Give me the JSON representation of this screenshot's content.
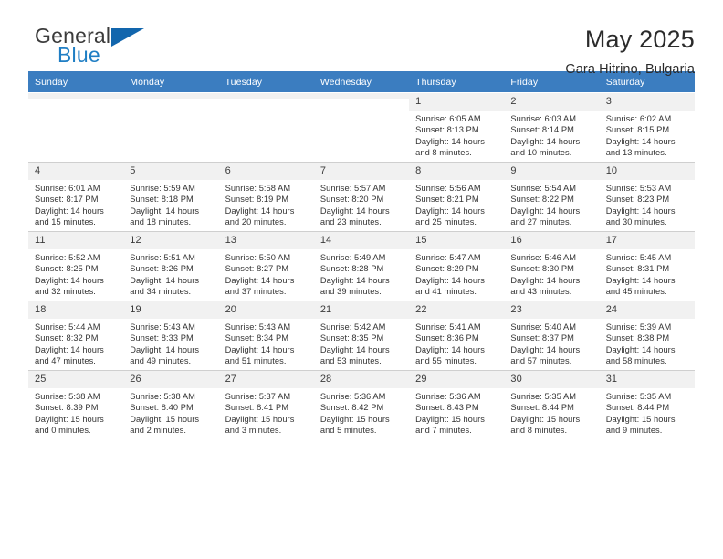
{
  "brand": {
    "word1": "General",
    "word2": "Blue",
    "triangle_color": "#1266ad",
    "blue_color": "#1f7ec4"
  },
  "header": {
    "title": "May 2025",
    "subtitle": "Gara Hitrino, Bulgaria"
  },
  "theme": {
    "header_bg": "#3b7dc0",
    "daynum_bg": "#f1f1f1",
    "grid_line": "#cfcfcf"
  },
  "weekday_headers": [
    "Sunday",
    "Monday",
    "Tuesday",
    "Wednesday",
    "Thursday",
    "Friday",
    "Saturday"
  ],
  "labels": {
    "sunrise_prefix": "Sunrise:",
    "sunset_prefix": "Sunset:",
    "daylight_prefix": "Daylight:"
  },
  "weeks": [
    [
      {
        "day": "",
        "sunrise": "",
        "sunset": "",
        "daylight": "",
        "empty": true
      },
      {
        "day": "",
        "sunrise": "",
        "sunset": "",
        "daylight": "",
        "empty": true
      },
      {
        "day": "",
        "sunrise": "",
        "sunset": "",
        "daylight": "",
        "empty": true
      },
      {
        "day": "",
        "sunrise": "",
        "sunset": "",
        "daylight": "",
        "empty": true
      },
      {
        "day": "1",
        "sunrise": "Sunrise: 6:05 AM",
        "sunset": "Sunset: 8:13 PM",
        "daylight": "Daylight: 14 hours and 8 minutes."
      },
      {
        "day": "2",
        "sunrise": "Sunrise: 6:03 AM",
        "sunset": "Sunset: 8:14 PM",
        "daylight": "Daylight: 14 hours and 10 minutes."
      },
      {
        "day": "3",
        "sunrise": "Sunrise: 6:02 AM",
        "sunset": "Sunset: 8:15 PM",
        "daylight": "Daylight: 14 hours and 13 minutes."
      }
    ],
    [
      {
        "day": "4",
        "sunrise": "Sunrise: 6:01 AM",
        "sunset": "Sunset: 8:17 PM",
        "daylight": "Daylight: 14 hours and 15 minutes."
      },
      {
        "day": "5",
        "sunrise": "Sunrise: 5:59 AM",
        "sunset": "Sunset: 8:18 PM",
        "daylight": "Daylight: 14 hours and 18 minutes."
      },
      {
        "day": "6",
        "sunrise": "Sunrise: 5:58 AM",
        "sunset": "Sunset: 8:19 PM",
        "daylight": "Daylight: 14 hours and 20 minutes."
      },
      {
        "day": "7",
        "sunrise": "Sunrise: 5:57 AM",
        "sunset": "Sunset: 8:20 PM",
        "daylight": "Daylight: 14 hours and 23 minutes."
      },
      {
        "day": "8",
        "sunrise": "Sunrise: 5:56 AM",
        "sunset": "Sunset: 8:21 PM",
        "daylight": "Daylight: 14 hours and 25 minutes."
      },
      {
        "day": "9",
        "sunrise": "Sunrise: 5:54 AM",
        "sunset": "Sunset: 8:22 PM",
        "daylight": "Daylight: 14 hours and 27 minutes."
      },
      {
        "day": "10",
        "sunrise": "Sunrise: 5:53 AM",
        "sunset": "Sunset: 8:23 PM",
        "daylight": "Daylight: 14 hours and 30 minutes."
      }
    ],
    [
      {
        "day": "11",
        "sunrise": "Sunrise: 5:52 AM",
        "sunset": "Sunset: 8:25 PM",
        "daylight": "Daylight: 14 hours and 32 minutes."
      },
      {
        "day": "12",
        "sunrise": "Sunrise: 5:51 AM",
        "sunset": "Sunset: 8:26 PM",
        "daylight": "Daylight: 14 hours and 34 minutes."
      },
      {
        "day": "13",
        "sunrise": "Sunrise: 5:50 AM",
        "sunset": "Sunset: 8:27 PM",
        "daylight": "Daylight: 14 hours and 37 minutes."
      },
      {
        "day": "14",
        "sunrise": "Sunrise: 5:49 AM",
        "sunset": "Sunset: 8:28 PM",
        "daylight": "Daylight: 14 hours and 39 minutes."
      },
      {
        "day": "15",
        "sunrise": "Sunrise: 5:47 AM",
        "sunset": "Sunset: 8:29 PM",
        "daylight": "Daylight: 14 hours and 41 minutes."
      },
      {
        "day": "16",
        "sunrise": "Sunrise: 5:46 AM",
        "sunset": "Sunset: 8:30 PM",
        "daylight": "Daylight: 14 hours and 43 minutes."
      },
      {
        "day": "17",
        "sunrise": "Sunrise: 5:45 AM",
        "sunset": "Sunset: 8:31 PM",
        "daylight": "Daylight: 14 hours and 45 minutes."
      }
    ],
    [
      {
        "day": "18",
        "sunrise": "Sunrise: 5:44 AM",
        "sunset": "Sunset: 8:32 PM",
        "daylight": "Daylight: 14 hours and 47 minutes."
      },
      {
        "day": "19",
        "sunrise": "Sunrise: 5:43 AM",
        "sunset": "Sunset: 8:33 PM",
        "daylight": "Daylight: 14 hours and 49 minutes."
      },
      {
        "day": "20",
        "sunrise": "Sunrise: 5:43 AM",
        "sunset": "Sunset: 8:34 PM",
        "daylight": "Daylight: 14 hours and 51 minutes."
      },
      {
        "day": "21",
        "sunrise": "Sunrise: 5:42 AM",
        "sunset": "Sunset: 8:35 PM",
        "daylight": "Daylight: 14 hours and 53 minutes."
      },
      {
        "day": "22",
        "sunrise": "Sunrise: 5:41 AM",
        "sunset": "Sunset: 8:36 PM",
        "daylight": "Daylight: 14 hours and 55 minutes."
      },
      {
        "day": "23",
        "sunrise": "Sunrise: 5:40 AM",
        "sunset": "Sunset: 8:37 PM",
        "daylight": "Daylight: 14 hours and 57 minutes."
      },
      {
        "day": "24",
        "sunrise": "Sunrise: 5:39 AM",
        "sunset": "Sunset: 8:38 PM",
        "daylight": "Daylight: 14 hours and 58 minutes."
      }
    ],
    [
      {
        "day": "25",
        "sunrise": "Sunrise: 5:38 AM",
        "sunset": "Sunset: 8:39 PM",
        "daylight": "Daylight: 15 hours and 0 minutes."
      },
      {
        "day": "26",
        "sunrise": "Sunrise: 5:38 AM",
        "sunset": "Sunset: 8:40 PM",
        "daylight": "Daylight: 15 hours and 2 minutes."
      },
      {
        "day": "27",
        "sunrise": "Sunrise: 5:37 AM",
        "sunset": "Sunset: 8:41 PM",
        "daylight": "Daylight: 15 hours and 3 minutes."
      },
      {
        "day": "28",
        "sunrise": "Sunrise: 5:36 AM",
        "sunset": "Sunset: 8:42 PM",
        "daylight": "Daylight: 15 hours and 5 minutes."
      },
      {
        "day": "29",
        "sunrise": "Sunrise: 5:36 AM",
        "sunset": "Sunset: 8:43 PM",
        "daylight": "Daylight: 15 hours and 7 minutes."
      },
      {
        "day": "30",
        "sunrise": "Sunrise: 5:35 AM",
        "sunset": "Sunset: 8:44 PM",
        "daylight": "Daylight: 15 hours and 8 minutes."
      },
      {
        "day": "31",
        "sunrise": "Sunrise: 5:35 AM",
        "sunset": "Sunset: 8:44 PM",
        "daylight": "Daylight: 15 hours and 9 minutes."
      }
    ]
  ]
}
